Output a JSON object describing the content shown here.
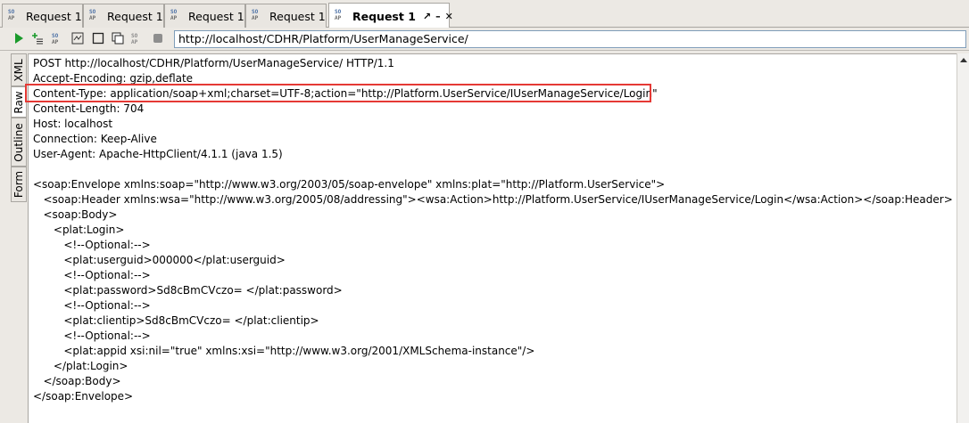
{
  "tabs": [
    {
      "label": "Request 1",
      "active": false
    },
    {
      "label": "Request 1",
      "active": false
    },
    {
      "label": "Request 1",
      "active": false
    },
    {
      "label": "Request 1",
      "active": false
    },
    {
      "label": "Request 1",
      "active": true
    }
  ],
  "tab_icon": "soap-request-icon",
  "toolbar": {
    "url": "http://localhost/CDHR/Platform/UserManageService/",
    "buttons": [
      "run-icon",
      "add-step-icon",
      "soap-icon",
      "add-assertion-icon",
      "stop-icon",
      "copy-icon",
      "soap-settings-icon",
      "cancel-icon"
    ]
  },
  "side_tabs": [
    "XML",
    "Raw",
    "Outline",
    "Form"
  ],
  "raw_lines": [
    "POST http://localhost/CDHR/Platform/UserManageService/ HTTP/1.1",
    "Accept-Encoding: gzip,deflate",
    "Content-Type: application/soap+xml;charset=UTF-8;action=\"http://Platform.UserService/IUserManageService/Login\"",
    "Content-Length: 704",
    "Host: localhost",
    "Connection: Keep-Alive",
    "User-Agent: Apache-HttpClient/4.1.1 (java 1.5)",
    "",
    "<soap:Envelope xmlns:soap=\"http://www.w3.org/2003/05/soap-envelope\" xmlns:plat=\"http://Platform.UserService\">",
    "   <soap:Header xmlns:wsa=\"http://www.w3.org/2005/08/addressing\"><wsa:Action>http://Platform.UserService/IUserManageService/Login</wsa:Action></soap:Header>",
    "   <soap:Body>",
    "      <plat:Login>",
    "         <!--Optional:-->",
    "         <plat:userguid>000000</plat:userguid>",
    "         <!--Optional:-->",
    "         <plat:password>Sd8cBmCVczo= </plat:password>",
    "         <!--Optional:-->",
    "         <plat:clientip>Sd8cBmCVczo= </plat:clientip>",
    "         <!--Optional:-->",
    "         <plat:appid xsi:nil=\"true\" xmlns:xsi=\"http://www.w3.org/2001/XMLSchema-instance\"/>",
    "      </plat:Login>",
    "   </soap:Body>",
    "</soap:Envelope>"
  ],
  "colors": {
    "highlight": "#e53935",
    "run": "#1a9a2b"
  }
}
